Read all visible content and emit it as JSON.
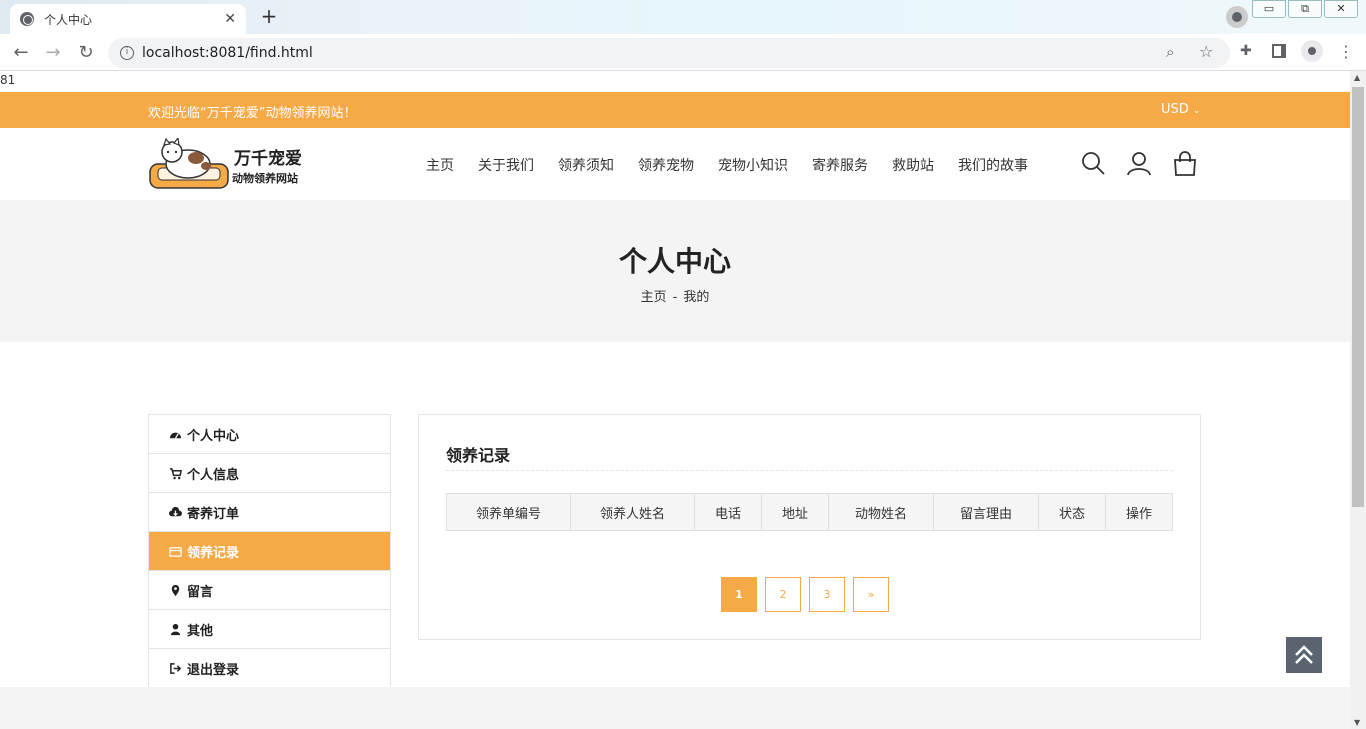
{
  "browser": {
    "tab_title": "个人中心",
    "tab_close": "✕",
    "new_tab": "+",
    "url": "localhost:8081/find.html",
    "window_minimize": "▭",
    "window_restore": "⧉",
    "window_close": "✕"
  },
  "page": {
    "stray_text": "81",
    "topbar": {
      "welcome": "欢迎光临“万千宠爱”动物领养网站！",
      "currency": "USD"
    },
    "logo": {
      "title": "万千宠爱",
      "subtitle": "动物领养网站"
    },
    "nav": [
      "主页",
      "关于我们",
      "领养须知",
      "领养宠物",
      "宠物小知识",
      "寄养服务",
      "救助站",
      "我们的故事"
    ],
    "banner": {
      "title": "个人中心",
      "breadcrumb_home": "主页",
      "breadcrumb_sep": "-",
      "breadcrumb_current": "我的"
    },
    "sidebar": [
      {
        "label": "个人中心",
        "icon": "dashboard-icon",
        "active": false
      },
      {
        "label": "个人信息",
        "icon": "cart-icon",
        "active": false
      },
      {
        "label": "寄养订单",
        "icon": "cloud-download-icon",
        "active": false
      },
      {
        "label": "领养记录",
        "icon": "credit-card-icon",
        "active": true
      },
      {
        "label": "留言",
        "icon": "map-marker-icon",
        "active": false
      },
      {
        "label": "其他",
        "icon": "user-icon",
        "active": false
      },
      {
        "label": "退出登录",
        "icon": "sign-out-icon",
        "active": false
      }
    ],
    "panel": {
      "title": "领养记录",
      "columns": [
        "领养单编号",
        "领养人姓名",
        "电话",
        "地址",
        "动物姓名",
        "留言理由",
        "状态",
        "操作"
      ]
    },
    "pagination": [
      "1",
      "2",
      "3",
      "»"
    ],
    "pagination_active": "1",
    "colors": {
      "accent": "#f5a947",
      "back_to_top_bg": "#5a6370"
    }
  }
}
